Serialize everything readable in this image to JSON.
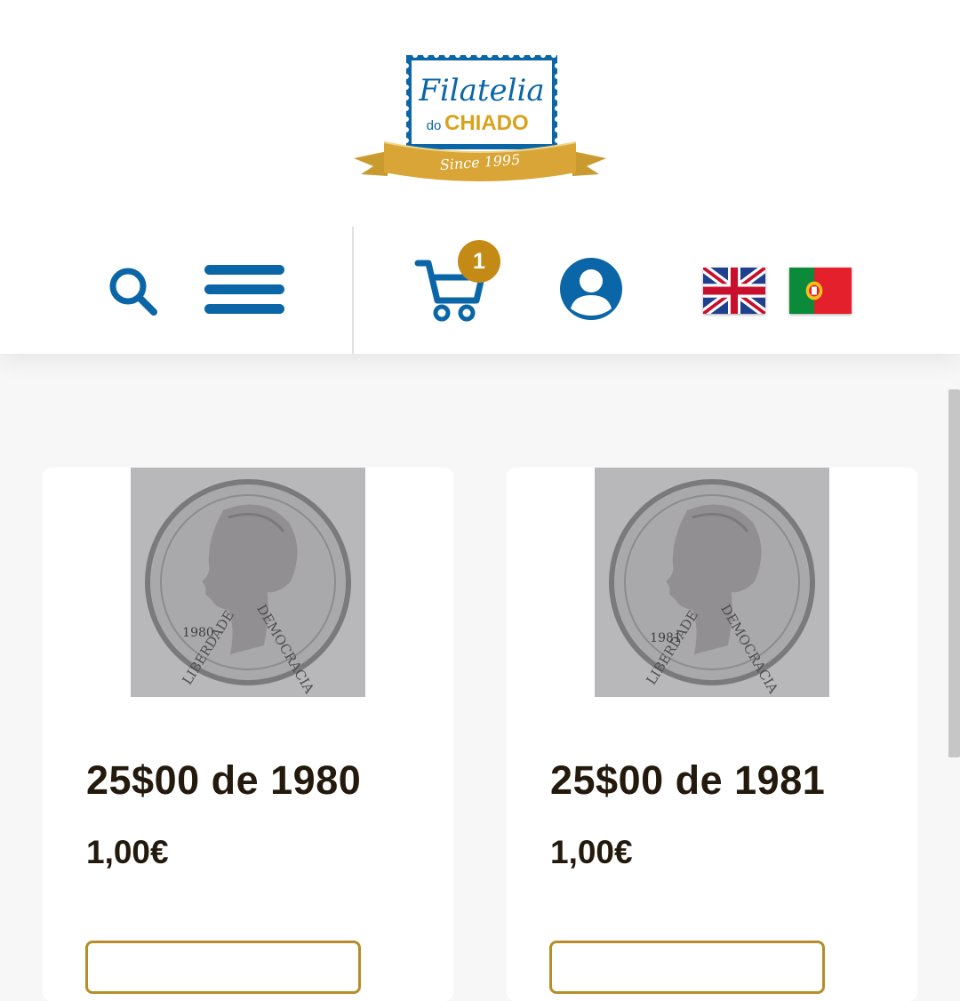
{
  "brand": {
    "name_line1": "Filatelia",
    "name_prefix": "do",
    "name_line2": "CHIADO",
    "tagline": "Since 1995",
    "colors": {
      "primary_blue": "#0a66a6",
      "gold": "#c48a16",
      "text_dark": "#231a0d"
    }
  },
  "nav": {
    "search_icon": "search-icon",
    "menu_icon": "hamburger-menu-icon",
    "cart_icon": "shopping-cart-icon",
    "cart_count": "1",
    "account_icon": "user-account-icon",
    "languages": [
      {
        "code": "en",
        "flag": "united-kingdom-flag-icon"
      },
      {
        "code": "pt",
        "flag": "portugal-flag-icon"
      }
    ]
  },
  "products": [
    {
      "title": "25$00 de 1980",
      "price": "1,00€",
      "coin_year": "1980",
      "coin_left": "LIBERDADE",
      "coin_right": "DEMOCRACIA"
    },
    {
      "title": "25$00 de 1981",
      "price": "1,00€",
      "coin_year": "1981",
      "coin_left": "LIBERDADE",
      "coin_right": "DEMOCRACIA"
    }
  ]
}
